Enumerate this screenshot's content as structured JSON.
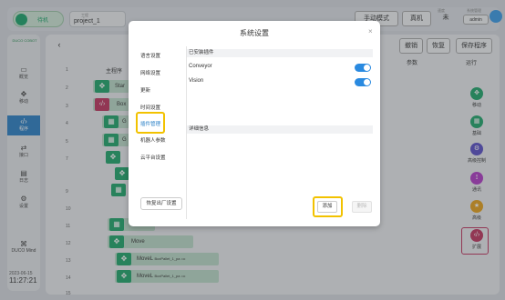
{
  "header": {
    "status": "待机",
    "project_label": "工程",
    "project": "project_1",
    "mode_btn": "手动模式",
    "real_btn": "真机",
    "col3_label": "速度",
    "col3_value": "未",
    "right_label": "系统管理",
    "right_value": "admin"
  },
  "sidebar": {
    "logo": "DUCO COBOT",
    "items": [
      {
        "label": "概览"
      },
      {
        "label": "移动"
      },
      {
        "label": "程序"
      },
      {
        "label": "接口"
      },
      {
        "label": "日志"
      },
      {
        "label": "设置"
      }
    ],
    "mind": "DUCO Mind",
    "date": "2023-06-15",
    "time": "11:27:21"
  },
  "toolbar": {
    "cancel": "撤销",
    "restore": "恢复",
    "save": "保存程序",
    "params": "参数",
    "run": "运行"
  },
  "tree": {
    "rows": [
      {
        "n": "1",
        "t": "主程序"
      },
      {
        "n": "2",
        "t": "Star"
      },
      {
        "n": "3",
        "t": "Box"
      },
      {
        "n": "4",
        "t": "G"
      },
      {
        "n": "5",
        "t": "G"
      },
      {
        "n": "6",
        "t": ""
      },
      {
        "n": "7",
        "t": ""
      },
      {
        "n": "8",
        "t": ""
      },
      {
        "n": "9",
        "t": ""
      },
      {
        "n": "10",
        "t": ""
      },
      {
        "n": "11",
        "t": "SetLoad"
      },
      {
        "n": "12",
        "t": "Move"
      },
      {
        "n": "13",
        "t": "MoveL",
        "p": "BoxPallet_1_pa",
        "m": "•••"
      },
      {
        "n": "14",
        "t": "MoveL",
        "p": "BoxPallet_1_pa",
        "m": "•••"
      },
      {
        "n": "15",
        "t": ""
      }
    ]
  },
  "rtools": [
    {
      "label": "移动"
    },
    {
      "label": "基础"
    },
    {
      "label": "高级控制"
    },
    {
      "label": "通讯"
    },
    {
      "label": "高级"
    },
    {
      "label": "扩展"
    }
  ],
  "modal": {
    "title": "系统设置",
    "close": "×",
    "menu": [
      "语言设置",
      "网络设置",
      "更新",
      "时间设置",
      "插件管理",
      "机器人参数",
      "云平台设置"
    ],
    "reset": "恢复出厂设置",
    "installed": "已安装插件",
    "plugins": [
      "Conveyor",
      "Vision"
    ],
    "details": "详细信息",
    "add": "添加",
    "delete": "删除"
  },
  "colors": {
    "accent": "#2a80c7",
    "green": "#1ea66b",
    "highlight": "#f2c200"
  }
}
